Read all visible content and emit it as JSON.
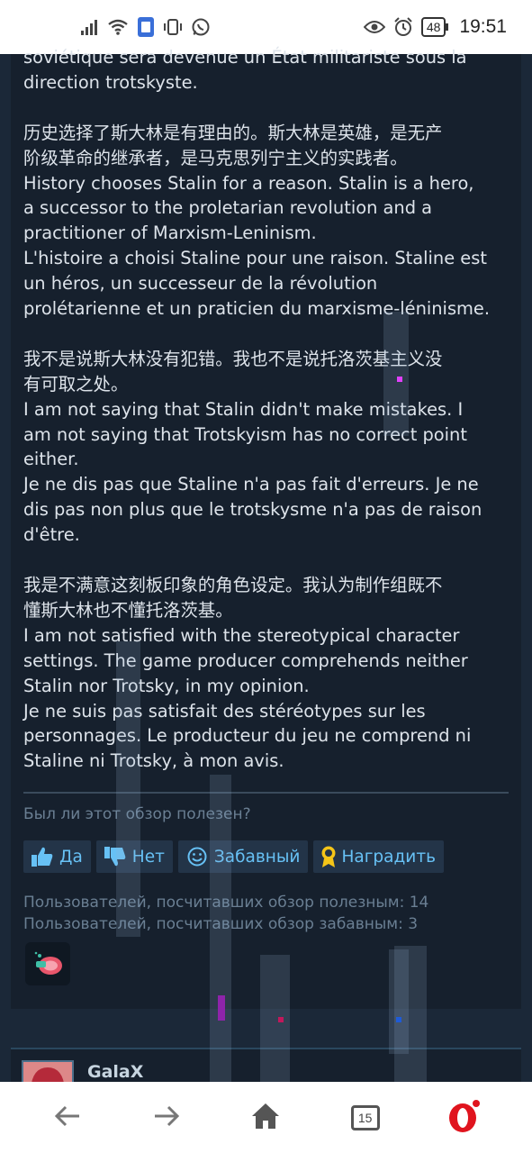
{
  "status_bar": {
    "time": "19:51",
    "battery": "48",
    "icons": [
      "signal-icon",
      "wifi-icon",
      "sim-icon",
      "vibrate-icon",
      "whatsapp-icon",
      "eye-icon",
      "alarm-icon",
      "battery-icon"
    ]
  },
  "review": {
    "paragraphs": [
      [
        "soviétique sera devenue un État militariste sous la",
        "direction trotskyste."
      ],
      [
        "历史选择了斯大林是有理由的。斯大林是英雄，是无产",
        "阶级革命的继承者，是马克思列宁主义的实践者。",
        "History chooses Stalin for a reason. Stalin is a hero,",
        "a successor to the proletarian revolution and a",
        "practitioner of Marxism-Leninism.",
        "L'histoire a choisi Staline pour une raison. Staline est",
        "un héros, un successeur de la révolution",
        "prolétarienne et un praticien du marxisme-léninisme."
      ],
      [
        "我不是说斯大林没有犯错。我也不是说托洛茨基主义没",
        "有可取之处。",
        "I am not saying that Stalin didn't make mistakes. I",
        "am not saying that Trotskyism has no correct point",
        "either.",
        "Je ne dis pas que Staline n'a pas fait d'erreurs. Je ne",
        "dis pas non plus que le trotskysme n'a pas de raison",
        "d'être."
      ],
      [
        "我是不满意这刻板印象的角色设定。我认为制作组既不",
        "懂斯大林也不懂托洛茨基。",
        "I am not satisfied with the stereotypical character",
        "settings. The game producer comprehends neither",
        "Stalin nor Trotsky, in my opinion.",
        "Je ne suis pas satisfait des stéréotypes sur les",
        "personnages. Le producteur du jeu ne comprend ni",
        "Staline ni Trotsky, à mon avis."
      ]
    ],
    "helpful_question": "Был ли этот обзор полезен?",
    "buttons": {
      "yes": "Да",
      "no": "Нет",
      "funny": "Забавный",
      "award": "Наградить"
    },
    "stats": {
      "helpful": "Пользователей, посчитавших обзор полезным: 14",
      "funny": "Пользователей, посчитавших обзор забавным: 3"
    }
  },
  "next_review": {
    "username": "GalaX"
  },
  "bottom_nav": {
    "tabs_count": "15",
    "icons": [
      "back-arrow-icon",
      "forward-arrow-icon",
      "home-icon",
      "tabs-icon",
      "opera-icon"
    ]
  },
  "colors": {
    "background": "#1b2838",
    "panel": "#16202d",
    "text": "#dde3ea",
    "muted": "#6a7f93",
    "link_blue": "#67c1f5",
    "button_bg": "#233448",
    "opera_red": "#e0141e"
  }
}
